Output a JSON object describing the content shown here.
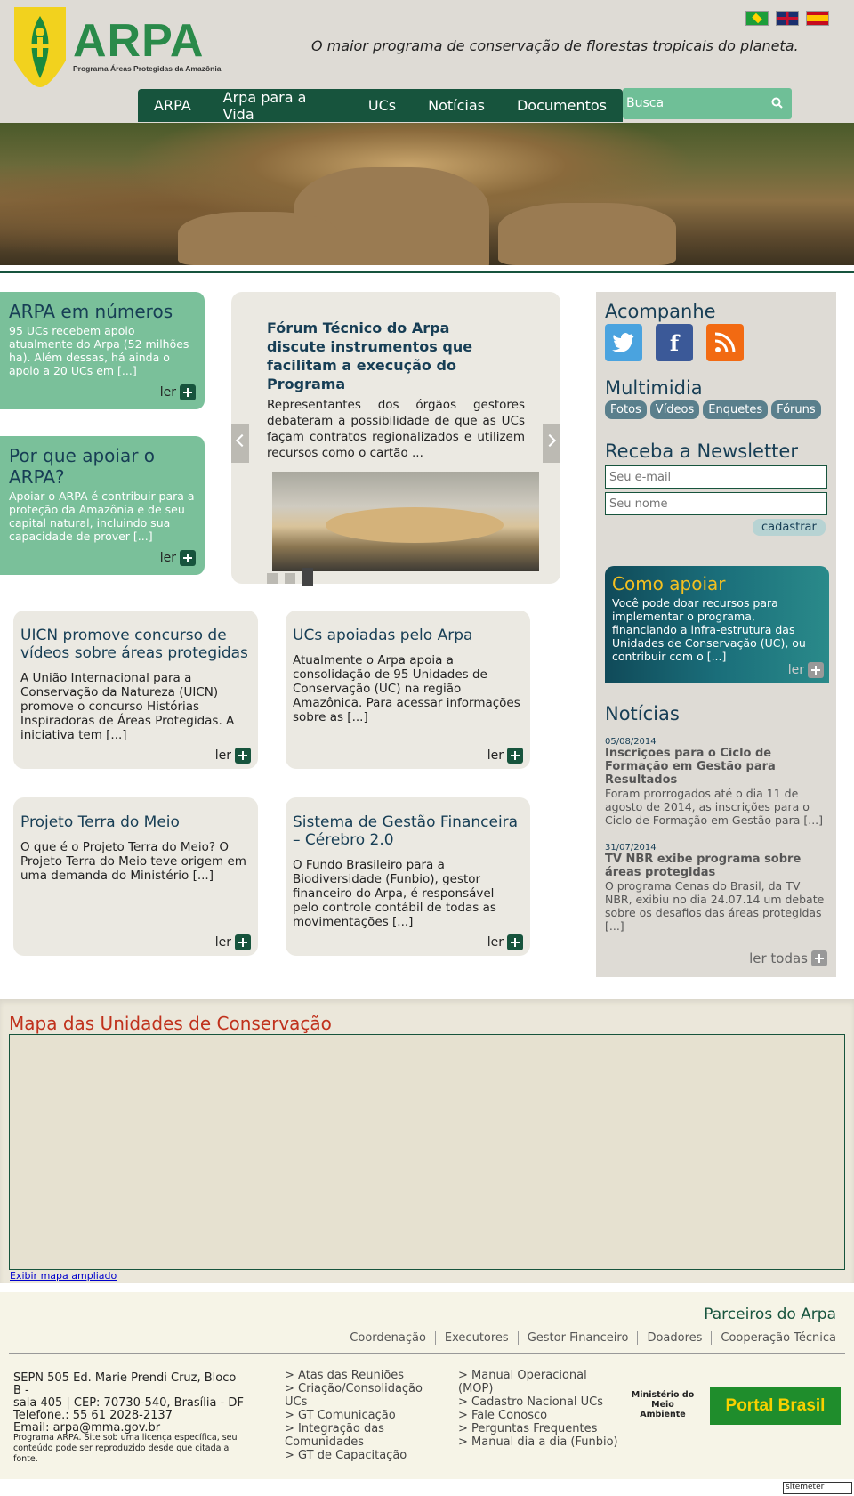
{
  "header": {
    "logo_text": "ARPA",
    "logo_sub": "Programa Áreas Protegidas da Amazônia",
    "tagline": "O maior programa de conservação de florestas tropicais do planeta.",
    "nav": [
      "ARPA",
      "Arpa para a Vida",
      "UCs",
      "Notícias",
      "Documentos"
    ],
    "search_placeholder": "Busca"
  },
  "colors": {
    "dark_green": "#17543d",
    "light_green": "#7ac09a",
    "navy": "#173e55",
    "map_title": "#c0311c"
  },
  "left_boxes": [
    {
      "title": "ARPA em números",
      "text": "95 UCs recebem apoio atualmente do Arpa (52 milhões ha). Além dessas, há ainda o apoio a 20 UCs em [...]",
      "ler": "ler"
    },
    {
      "title": "Por que apoiar o ARPA?",
      "text": "Apoiar o ARPA é contribuir para a proteção da Amazônia e de seu capital natural, incluindo sua capacidade de prover [...]",
      "ler": "ler"
    }
  ],
  "carousel": {
    "title": "Fórum Técnico do Arpa discute instrumentos que facilitam a execução do Programa",
    "text": "Representantes dos órgãos gestores debateram a possibilidade de que as UCs façam contratos regionalizados e utilizem recursos como o cartão ..."
  },
  "cards": [
    {
      "title": "UICN promove concurso de vídeos sobre áreas protegidas",
      "text": "A União Internacional para a Conservação da Natureza (UICN) promove o concurso Histórias Inspiradoras de Áreas Protegidas. A iniciativa tem [...]",
      "ler": "ler"
    },
    {
      "title": "UCs apoiadas pelo Arpa",
      "text": "Atualmente o Arpa apoia a consolidação de 95 Unidades de Conservação (UC) na região Amazônica. Para acessar informações sobre as [...]",
      "ler": "ler"
    },
    {
      "title": "Projeto Terra do Meio",
      "text": "O que é o Projeto Terra do Meio? O Projeto Terra do Meio teve origem em uma demanda do Ministério [...]",
      "ler": "ler"
    },
    {
      "title": "Sistema de Gestão Financeira – Cérebro 2.0",
      "text": "O Fundo Brasileiro para a Biodiversidade (Funbio), gestor financeiro do Arpa, é responsável pelo controle contábil de todas as movimentações [...]",
      "ler": "ler"
    }
  ],
  "sidebar": {
    "acompanhe": "Acompanhe",
    "social_icons": [
      "twitter-icon",
      "facebook-icon",
      "rss-icon"
    ],
    "multimidia": "Multimidia",
    "multimidia_tags": [
      "Fotos",
      "Vídeos",
      "Enquetes",
      "Fóruns"
    ],
    "newsletter": "Receba a Newsletter",
    "email_placeholder": "Seu e-mail",
    "name_placeholder": "Seu nome",
    "cadastrar": "cadastrar",
    "apoiar_title": "Como apoiar",
    "apoiar_text": "Você pode doar recursos para implementar o programa, financiando a infra-estrutura das Unidades de Conservação (UC), ou contribuir com o [...]",
    "apoiar_ler": "ler",
    "noticias": "Notícias",
    "news": [
      {
        "date": "05/08/2014",
        "title": "Inscrições para o Ciclo de Formação em Gestão para Resultados",
        "text": "Foram prorrogados até o dia 11 de agosto de 2014, as inscrições para o Ciclo de Formação em Gestão para [...]"
      },
      {
        "date": "31/07/2014",
        "title": "TV NBR exibe programa sobre áreas protegidas",
        "text": "O programa Cenas do Brasil, da TV NBR, exibiu no dia 24.07.14 um debate sobre os desafios das áreas protegidas [...]"
      }
    ],
    "ler_todas": "ler todas"
  },
  "map": {
    "title": "Mapa das Unidades de Conservação",
    "link": "Exibir mapa ampliado"
  },
  "footer": {
    "parceiros_title": "Parceiros do Arpa",
    "parceiros": [
      "Coordenação",
      "Executores",
      "Gestor Financeiro",
      "Doadores",
      "Cooperação Técnica"
    ],
    "address": [
      "SEPN 505 Ed. Marie Prendi Cruz, Bloco B -",
      "sala 405 | CEP: 70730-540, Brasília - DF",
      "Telefone.: 55 61 2028-2137",
      "Email: arpa@mma.gov.br"
    ],
    "license": "Programa ARPA. Site sob uma licença específica, seu conteúdo pode ser reproduzido desde que citada a fonte.",
    "links_col1": [
      "> Atas das Reuniões",
      "> Criação/Consolidação UCs",
      "> GT Comunicação",
      "> Integração das Comunidades",
      "> GT de Capacitação"
    ],
    "links_col2": [
      "> Manual Operacional (MOP)",
      "> Cadastro Nacional UCs",
      "> Fale Conosco",
      "> Perguntas Frequentes",
      "> Manual dia a dia (Funbio)"
    ],
    "mma": "Ministério do Meio Ambiente",
    "portal": "Portal Brasil",
    "sitemeter": "sitemeter"
  }
}
